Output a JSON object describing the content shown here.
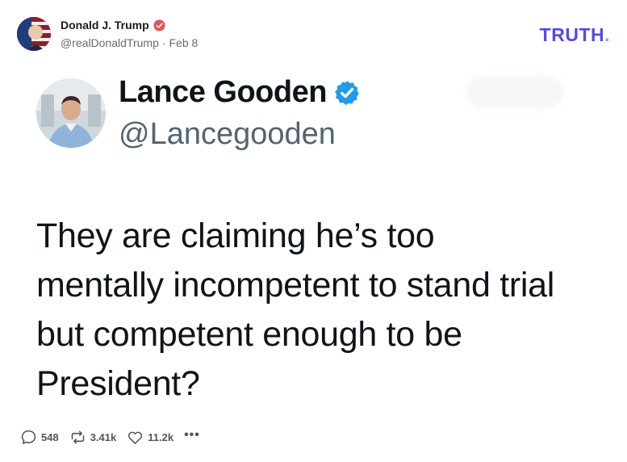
{
  "post": {
    "author_name": "Donald J. Trump",
    "author_handle": "@realDonaldTrump",
    "separator": "·",
    "date": "Feb 8",
    "logo_text": "TRUTH",
    "logo_dot": ".",
    "logo_color": "#5448ee",
    "logo_dot_color": "#4ad1b0",
    "verified_color": "#e8505b"
  },
  "embedded_tweet": {
    "name": "Lance Gooden",
    "handle": "@Lancegooden",
    "verified_color": "#1d9bf0",
    "text_lines": [
      "They are claiming he’s too",
      "mentally incompetent to stand trial",
      "but competent enough to be",
      "President?"
    ]
  },
  "actions": {
    "replies": "548",
    "retruths": "3.41k",
    "likes": "11.2k",
    "more": "•••",
    "icons": [
      "reply-icon",
      "retruth-icon",
      "like-icon",
      "more-icon"
    ]
  }
}
